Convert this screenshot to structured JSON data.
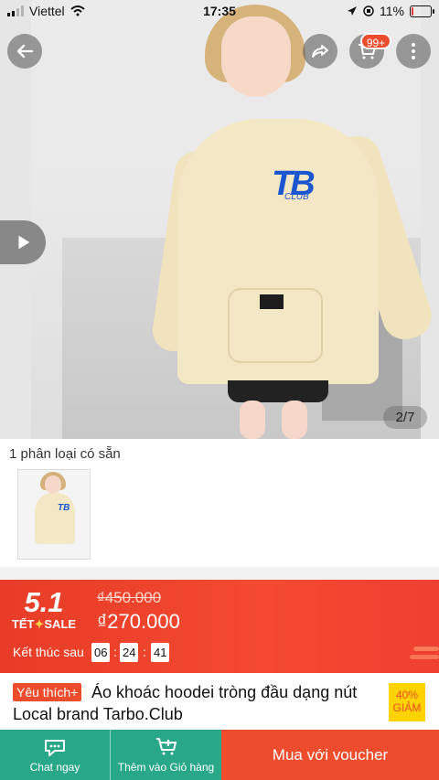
{
  "status_bar": {
    "carrier": "Viettel",
    "time": "17:35",
    "battery": "11%",
    "battery_level": 0.11
  },
  "media": {
    "counter": "2/7",
    "cart_badge": "99+"
  },
  "variants": {
    "label": "1 phân loại có sẵn"
  },
  "promo": {
    "sale_number": "5.1",
    "sale_word_1": "TẾT",
    "sale_word_2": "SALE",
    "old_price": "₫450.000",
    "new_price": "₫270.000",
    "ends_label": "Kết thúc sau",
    "timer": {
      "hours": "06",
      "minutes": "24",
      "seconds": "41"
    },
    "colors": {
      "primary": "#ee4d2d",
      "accent": "#ffd44a"
    }
  },
  "product": {
    "favorite_label": "Yêu thích+",
    "title_line_1": "Áo khoác hoodei tròng đầu dạng nút",
    "title_line_2": "Local brand Tarbo.Club",
    "discount_percent": "40%",
    "discount_label": "GIẢM"
  },
  "bottom_bar": {
    "chat": "Chat ngay",
    "add_to_cart": "Thêm vào Giỏ hàng",
    "buy": "Mua với voucher"
  },
  "icons": {
    "back": "back-arrow-icon",
    "share": "share-icon",
    "cart": "cart-icon",
    "more": "more-icon",
    "video": "play-icon",
    "chat": "chat-icon",
    "add_cart": "add-to-cart-icon"
  }
}
